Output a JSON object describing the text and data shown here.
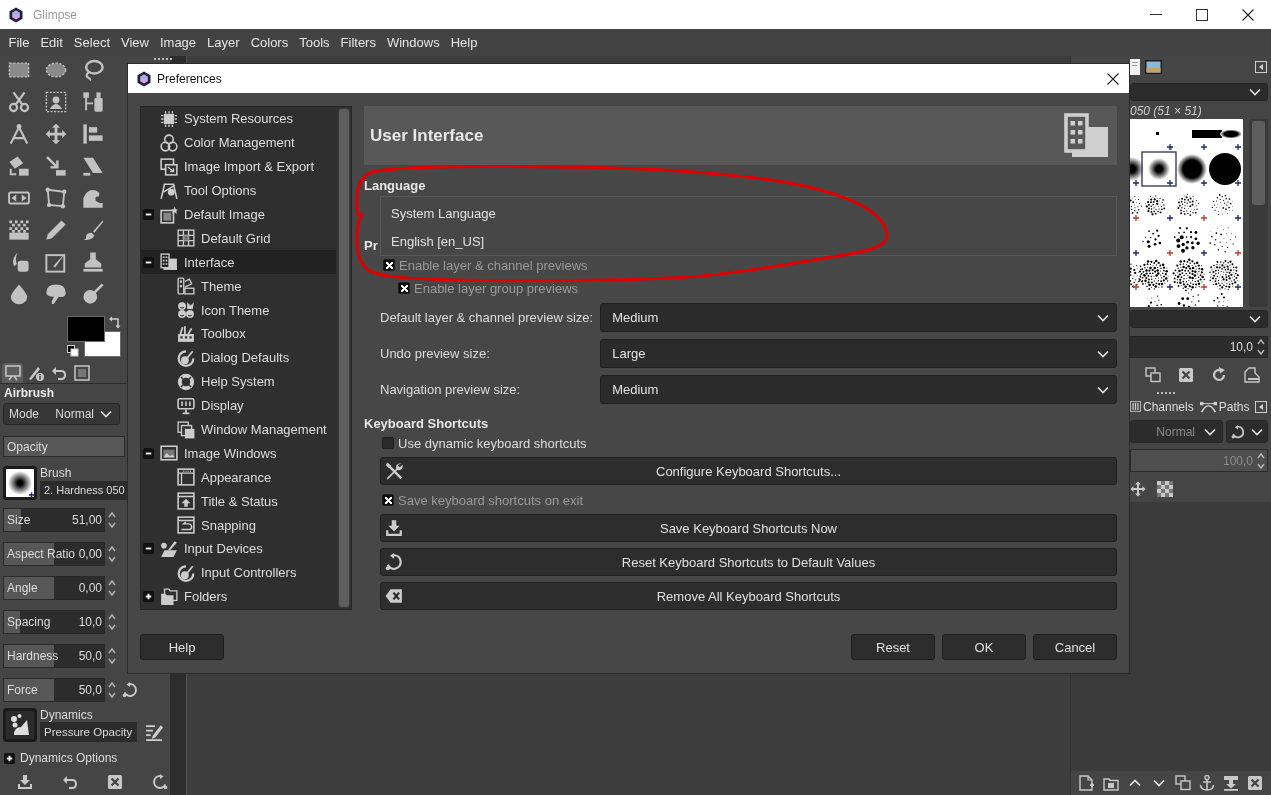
{
  "window": {
    "title": "Glimpse"
  },
  "menu": [
    "File",
    "Edit",
    "Select",
    "View",
    "Image",
    "Layer",
    "Colors",
    "Tools",
    "Filters",
    "Windows",
    "Help"
  ],
  "dock_tabs": [
    {
      "selected": true
    },
    {
      "selected": false
    },
    {
      "selected": false
    },
    {
      "selected": false
    }
  ],
  "tool_options": {
    "title": "Airbrush",
    "mode": {
      "label": "Mode",
      "value": "Normal"
    },
    "opacity": {
      "label": "Opacity",
      "level": 1
    },
    "brush": {
      "label": "Brush",
      "value": "2. Hardness 050"
    },
    "sliders": [
      {
        "label": "Size",
        "value": "51,00",
        "level": 0.17
      },
      {
        "label": "Aspect Ratio",
        "value": "0,00",
        "level": 0.5
      },
      {
        "label": "Angle",
        "value": "0,00",
        "level": 0.5
      },
      {
        "label": "Spacing",
        "value": "10,0",
        "level": 0.16
      },
      {
        "label": "Hardness",
        "value": "50,0",
        "level": 0.5
      },
      {
        "label": "Force",
        "value": "50,0",
        "level": 0.5
      }
    ],
    "dynamics": {
      "label": "Dynamics",
      "value": "Pressure Opacity"
    },
    "dynamics_options": {
      "label": "Dynamics Options",
      "expanded": false
    }
  },
  "brushes": {
    "caption": "050 (51 × 51)",
    "spacing": "10,0"
  },
  "layers": {
    "tabs": [
      {
        "label": "Channels",
        "selected": false
      },
      {
        "label": "Paths",
        "selected": false
      }
    ],
    "mode": "Normal",
    "opacity": {
      "value": "100,0",
      "level": 1
    },
    "disabled": true
  },
  "preferences": {
    "title": "Preferences",
    "tree": [
      {
        "label": "System Resources",
        "selected": false
      },
      {
        "label": "Color Management",
        "selected": false
      },
      {
        "label": "Image Import & Export",
        "selected": false
      },
      {
        "label": "Tool Options",
        "selected": false
      },
      {
        "label": "Default Image",
        "selected": false,
        "expanded": true,
        "children": [
          {
            "label": "Default Grid",
            "selected": false
          }
        ]
      },
      {
        "label": "Interface",
        "selected": true,
        "expanded": true,
        "children": [
          {
            "label": "Theme",
            "selected": false
          },
          {
            "label": "Icon Theme",
            "selected": false
          },
          {
            "label": "Toolbox",
            "selected": false
          },
          {
            "label": "Dialog Defaults",
            "selected": false
          },
          {
            "label": "Help System",
            "selected": false
          },
          {
            "label": "Display",
            "selected": false
          },
          {
            "label": "Window Management",
            "selected": false
          }
        ]
      },
      {
        "label": "Image Windows",
        "selected": false,
        "expanded": true,
        "children": [
          {
            "label": "Appearance",
            "selected": false
          },
          {
            "label": "Title & Status",
            "selected": false
          },
          {
            "label": "Snapping",
            "selected": false
          }
        ]
      },
      {
        "label": "Input Devices",
        "selected": false,
        "expanded": true,
        "children": [
          {
            "label": "Input Controllers",
            "selected": false
          }
        ]
      },
      {
        "label": "Folders",
        "selected": false,
        "expanded": false
      }
    ],
    "page_title": "User Interface",
    "language": {
      "heading": "Language",
      "options": [
        {
          "label": "System Language",
          "selected": false
        },
        {
          "label": "English [en_US]",
          "selected": false
        }
      ]
    },
    "preview_section": {
      "heading": "Pr",
      "checkboxes": [
        {
          "label": "Enable layer & channel previews",
          "checked": true,
          "children": [
            {
              "label": "Enable layer group previews",
              "checked": true
            }
          ]
        }
      ],
      "dropdowns": [
        {
          "label": "Default layer & channel preview size:",
          "value": "Medium"
        },
        {
          "label": "Undo preview size:",
          "value": "Large"
        },
        {
          "label": "Navigation preview size:",
          "value": "Medium"
        }
      ]
    },
    "keyboard_shortcuts": {
      "heading": "Keyboard Shortcuts",
      "items": [
        {
          "kind": "checkbox",
          "label": "Use dynamic keyboard shortcuts",
          "checked": false
        },
        {
          "kind": "button",
          "label": "Configure Keyboard Shortcuts..."
        },
        {
          "kind": "checkbox",
          "label": "Save keyboard shortcuts on exit",
          "checked": true
        },
        {
          "kind": "button",
          "label": "Save Keyboard Shortcuts Now"
        },
        {
          "kind": "button",
          "label": "Reset Keyboard Shortcuts to Default Values"
        },
        {
          "kind": "button",
          "label": "Remove All Keyboard Shortcuts"
        }
      ]
    },
    "buttons": [
      "Help",
      "Reset",
      "OK",
      "Cancel"
    ]
  },
  "annotation": {
    "kind": "ellipse"
  }
}
